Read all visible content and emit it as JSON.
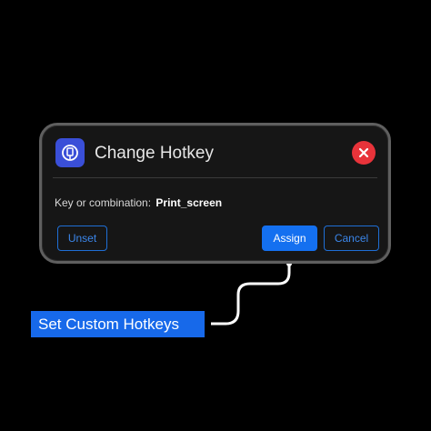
{
  "dialog": {
    "title": "Change Hotkey",
    "close_icon": "close-icon",
    "app_icon": "hotkey-app-icon",
    "key_label": "Key or combination:",
    "key_value": "Print_screen",
    "buttons": {
      "unset": "Unset",
      "assign": "Assign",
      "cancel": "Cancel"
    }
  },
  "callout": {
    "label": "Set Custom Hotkeys"
  },
  "colors": {
    "accent": "#1470f0",
    "close": "#e8333a",
    "app_icon": "#3a4fd8",
    "dialog_bg": "#161616",
    "page_bg": "#000000"
  }
}
